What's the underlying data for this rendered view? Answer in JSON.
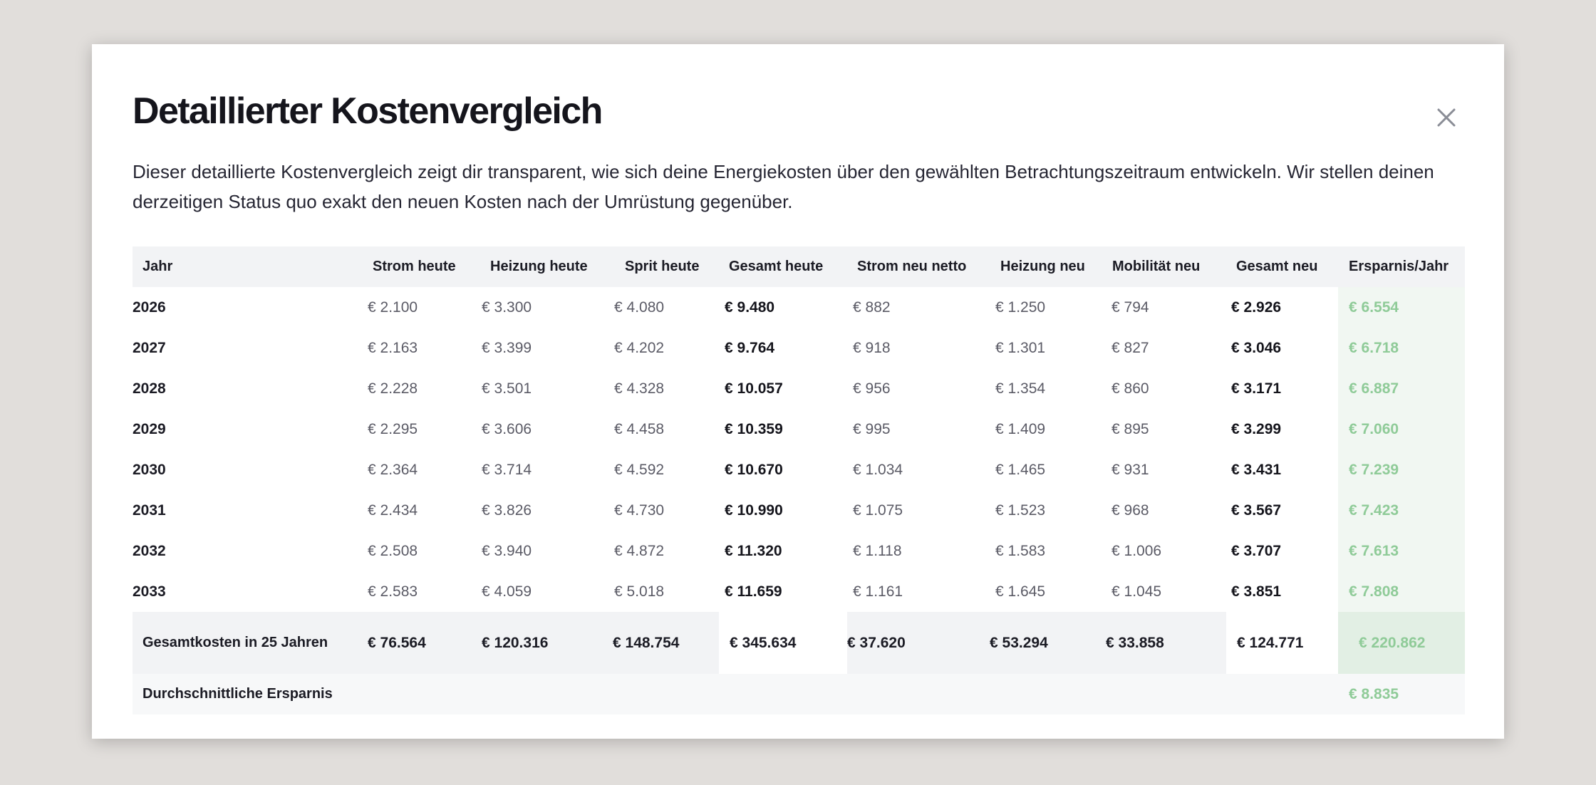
{
  "modal": {
    "title": "Detaillierter Kostenvergleich",
    "close_icon": "close-icon",
    "description": "Dieser detaillierte Kostenvergleich zeigt dir transparent, wie sich deine Energiekosten über den gewählten Betrachtungszeitraum entwickeln. Wir stellen deinen derzeitigen Status quo exakt den neuen Kosten nach der Umrüstung gegenüber."
  },
  "table": {
    "headers": [
      "Jahr",
      "Strom heute",
      "Heizung heute",
      "Sprit heute",
      "Gesamt heute",
      "Strom neu netto",
      "Heizung neu",
      "Mobilität neu",
      "Gesamt neu",
      "Ersparnis/Jahr"
    ],
    "rows": [
      [
        "2026",
        "€ 2.100",
        "€ 3.300",
        "€ 4.080",
        "€ 9.480",
        "€ 882",
        "€ 1.250",
        "€ 794",
        "€ 2.926",
        "€ 6.554"
      ],
      [
        "2027",
        "€ 2.163",
        "€ 3.399",
        "€ 4.202",
        "€ 9.764",
        "€ 918",
        "€ 1.301",
        "€ 827",
        "€ 3.046",
        "€ 6.718"
      ],
      [
        "2028",
        "€ 2.228",
        "€ 3.501",
        "€ 4.328",
        "€ 10.057",
        "€ 956",
        "€ 1.354",
        "€ 860",
        "€ 3.171",
        "€ 6.887"
      ],
      [
        "2029",
        "€ 2.295",
        "€ 3.606",
        "€ 4.458",
        "€ 10.359",
        "€ 995",
        "€ 1.409",
        "€ 895",
        "€ 3.299",
        "€ 7.060"
      ],
      [
        "2030",
        "€ 2.364",
        "€ 3.714",
        "€ 4.592",
        "€ 10.670",
        "€ 1.034",
        "€ 1.465",
        "€ 931",
        "€ 3.431",
        "€ 7.239"
      ],
      [
        "2031",
        "€ 2.434",
        "€ 3.826",
        "€ 4.730",
        "€ 10.990",
        "€ 1.075",
        "€ 1.523",
        "€ 968",
        "€ 3.567",
        "€ 7.423"
      ],
      [
        "2032",
        "€ 2.508",
        "€ 3.940",
        "€ 4.872",
        "€ 11.320",
        "€ 1.118",
        "€ 1.583",
        "€ 1.006",
        "€ 3.707",
        "€ 7.613"
      ],
      [
        "2033",
        "€ 2.583",
        "€ 4.059",
        "€ 5.018",
        "€ 11.659",
        "€ 1.161",
        "€ 1.645",
        "€ 1.045",
        "€ 3.851",
        "€ 7.808"
      ]
    ],
    "total": {
      "label": "Gesamtkosten in 25 Jahren",
      "values": [
        "€ 76.564",
        "€ 120.316",
        "€ 148.754",
        "€ 345.634",
        "€ 37.620",
        "€ 53.294",
        "€ 33.858",
        "€ 124.771",
        "€ 220.862"
      ]
    },
    "average": {
      "label": "Durchschnittliche Ersparnis",
      "value": "€ 8.835"
    }
  },
  "colors": {
    "savings_green": "#8fcb98",
    "header_bg": "#f2f3f5",
    "backdrop": "#e1dedb"
  }
}
